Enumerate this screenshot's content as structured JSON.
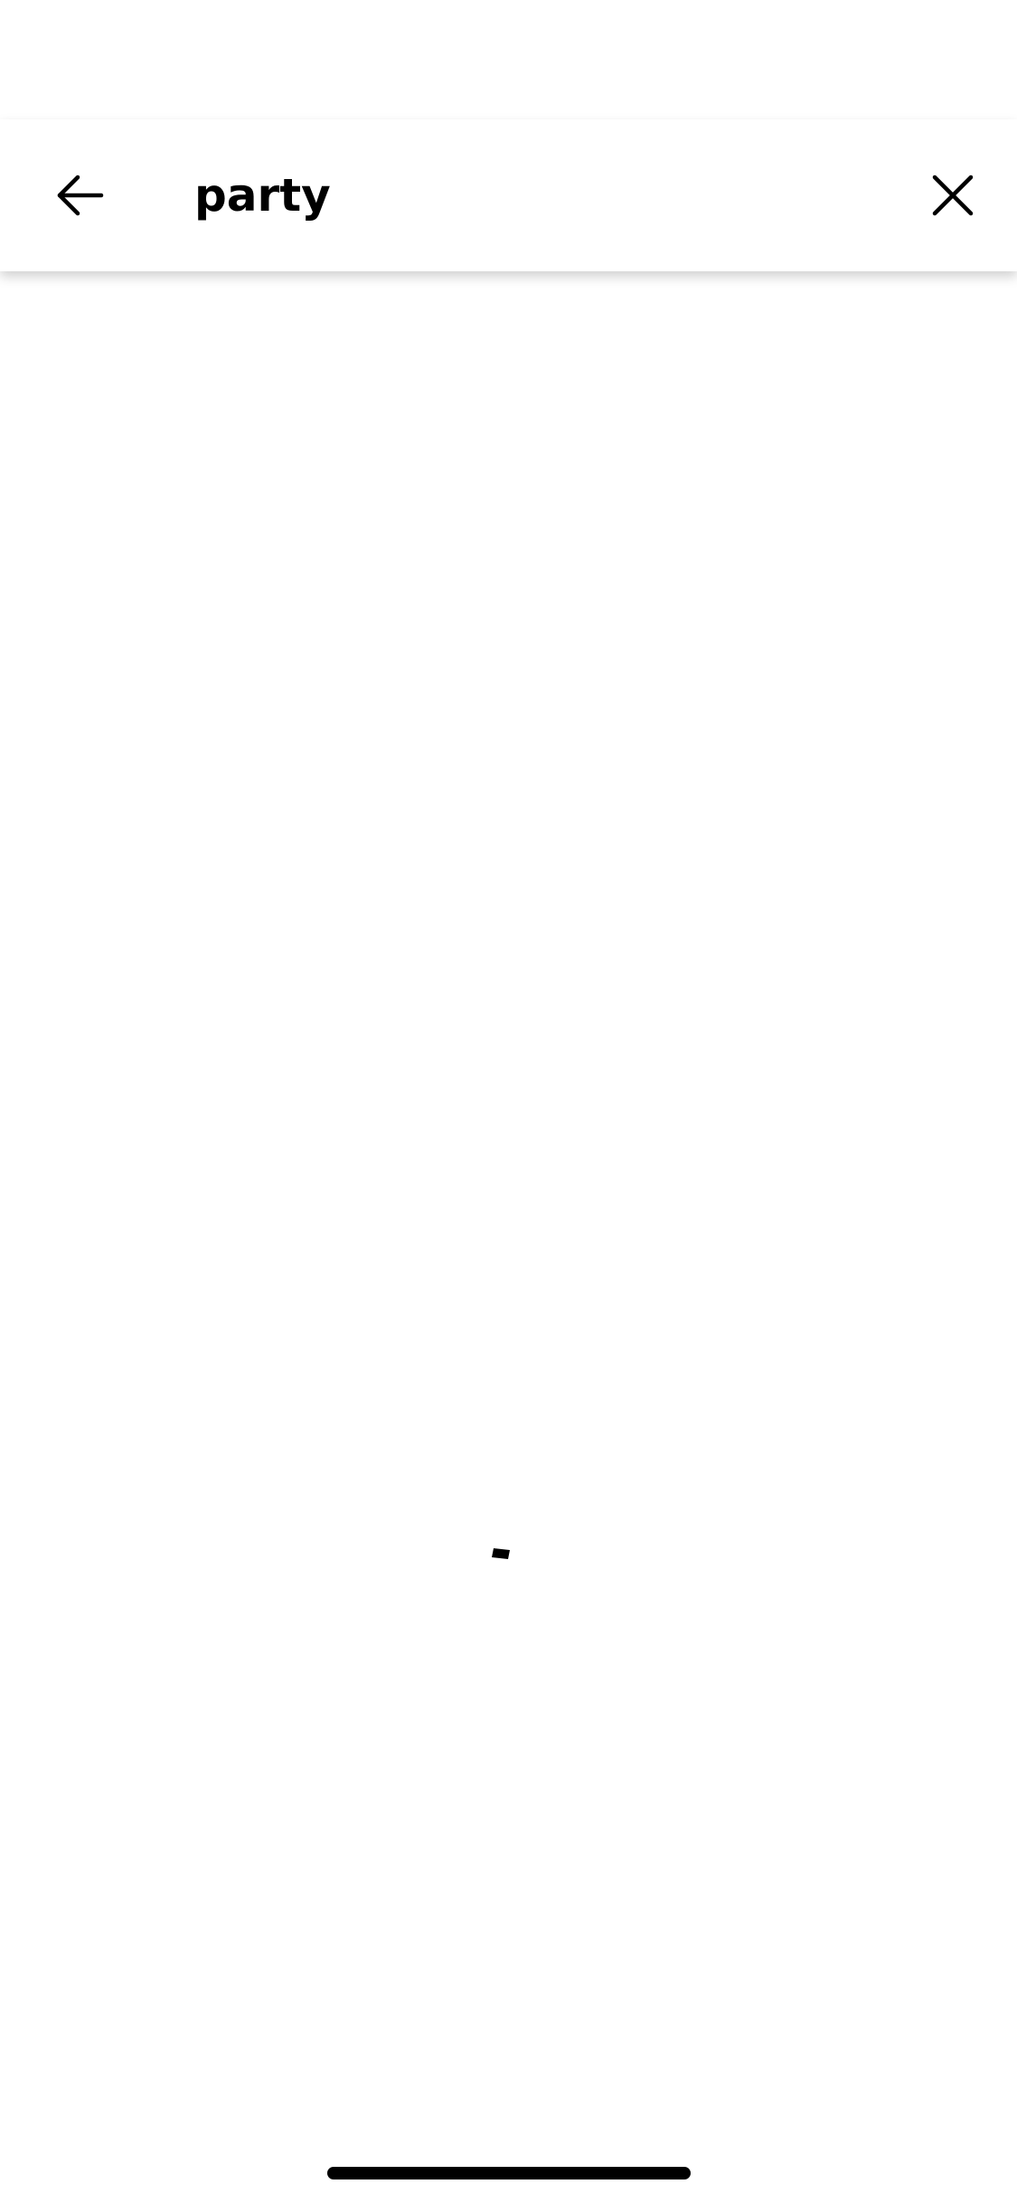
{
  "search": {
    "query": "party"
  },
  "icons": {
    "back": "arrow-left-icon",
    "clear": "close-icon",
    "loading": "loading-spinner-icon"
  },
  "colors": {
    "background": "#ffffff",
    "text": "#000000"
  }
}
